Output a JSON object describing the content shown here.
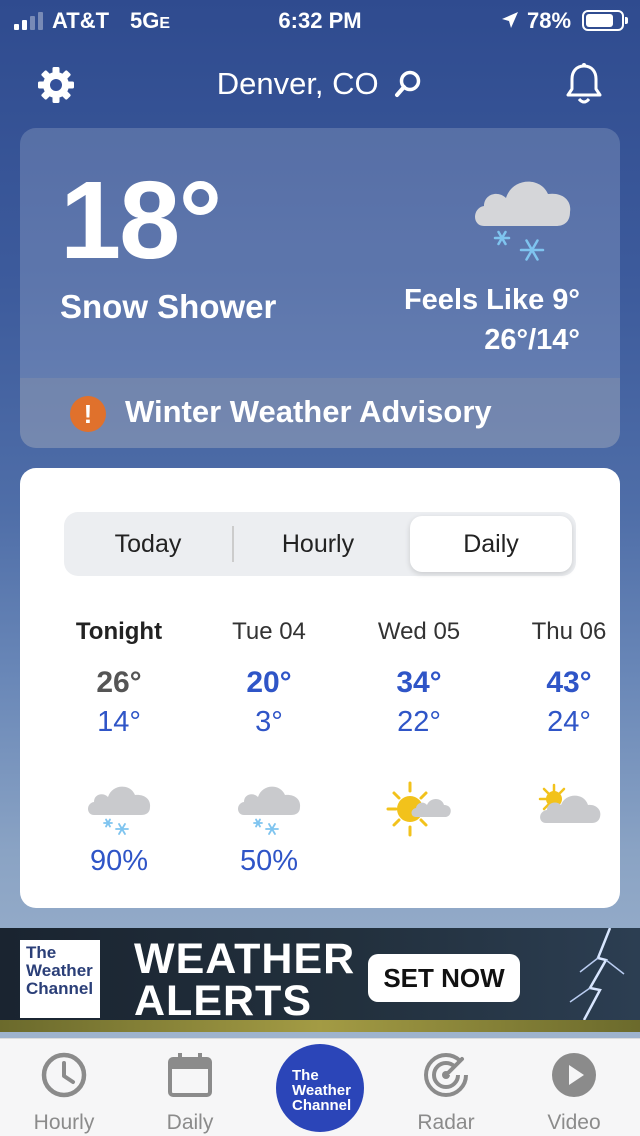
{
  "status_bar": {
    "carrier": "AT&T",
    "network": "5G",
    "network_suffix": "E",
    "time": "6:32 PM",
    "battery": "78%"
  },
  "header": {
    "location": "Denver, CO"
  },
  "current": {
    "temperature": "18°",
    "condition": "Snow Shower",
    "feels_like": "Feels Like 9°",
    "high_low": "26°/14°",
    "icon": "cloud-snow-icon",
    "advisory": "Winter Weather Advisory"
  },
  "forecast": {
    "tabs": [
      "Today",
      "Hourly",
      "Daily"
    ],
    "active_tab": "Daily",
    "days": [
      {
        "label": "Tonight",
        "high": "26°",
        "low": "14°",
        "icon": "cloud-snow-icon",
        "precip": "90%",
        "high_color": "#555555"
      },
      {
        "label": "Tue 04",
        "high": "20°",
        "low": "3°",
        "icon": "cloud-snow-icon",
        "precip": "50%",
        "high_color": "#2f55c7"
      },
      {
        "label": "Wed 05",
        "high": "34°",
        "low": "22°",
        "icon": "sun-cloud-icon",
        "precip": "",
        "high_color": "#2f55c7"
      },
      {
        "label": "Thu 06",
        "high": "43°",
        "low": "24°",
        "icon": "partly-cloudy-icon",
        "precip": "",
        "high_color": "#2f55c7"
      }
    ]
  },
  "ad": {
    "logo_lines": [
      "The",
      "Weather",
      "Channel"
    ],
    "title_line1": "WEATHER",
    "title_line2": "ALERTS",
    "cta": "SET NOW"
  },
  "tabbar": {
    "items": [
      {
        "label": "Hourly",
        "icon": "clock-icon"
      },
      {
        "label": "Daily",
        "icon": "calendar-icon"
      },
      {
        "label": "Radar",
        "icon": "radar-icon"
      },
      {
        "label": "Video",
        "icon": "play-icon"
      }
    ],
    "center_lines": [
      "The",
      "Weather",
      "Channel"
    ]
  },
  "colors": {
    "accent_blue": "#2f55c7",
    "advisory_orange": "#e0712c",
    "twc_blue": "#2b45b8"
  }
}
